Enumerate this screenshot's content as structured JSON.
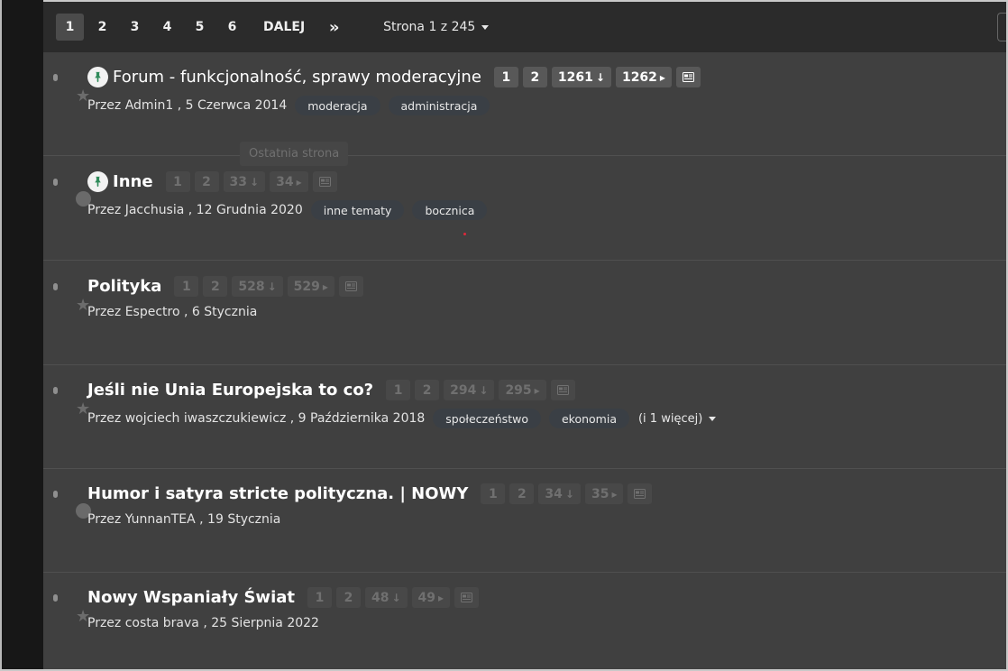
{
  "pagination": {
    "pages": [
      "1",
      "2",
      "3",
      "4",
      "5",
      "6"
    ],
    "next_label": "DALEJ",
    "last_label": "»",
    "page_select": "Strona 1 z 245"
  },
  "tooltip": "Ostatnia strona",
  "threads": [
    {
      "title": "Forum - funkcjonalność, sprawy moderacyjne",
      "pinned": true,
      "pages": [
        "1",
        "2",
        "1261",
        "1262"
      ],
      "meta": "Przez Admin1 , 5 Czerwca 2014",
      "tags": [
        "moderacja",
        "administracja"
      ]
    },
    {
      "title": "Inne",
      "pinned": true,
      "pages": [
        "1",
        "2",
        "33",
        "34"
      ],
      "meta": "Przez Jacchusia , 12 Grudnia 2020",
      "tags": [
        "inne tematy",
        "bocznica"
      ]
    },
    {
      "title": "Polityka",
      "pinned": false,
      "pages": [
        "1",
        "2",
        "528",
        "529"
      ],
      "meta": "Przez Espectro , 6 Stycznia",
      "tags": []
    },
    {
      "title": "Jeśli nie Unia Europejska to co?",
      "pinned": false,
      "pages": [
        "1",
        "2",
        "294",
        "295"
      ],
      "meta": "Przez wojciech iwaszczukiewicz , 9 Października 2018",
      "tags": [
        "społeczeństwo",
        "ekonomia"
      ],
      "more": "(i 1 więcej)"
    },
    {
      "title": "Humor i satyra stricte polityczna. | NOWY",
      "pinned": false,
      "pages": [
        "1",
        "2",
        "34",
        "35"
      ],
      "meta": "Przez YunnanTEA , 19 Stycznia",
      "tags": []
    },
    {
      "title": "Nowy Wspaniały Świat",
      "pinned": false,
      "pages": [
        "1",
        "2",
        "48",
        "49"
      ],
      "meta": "Przez costa brava , 25 Sierpnia 2022",
      "tags": []
    }
  ],
  "icons": {
    "pin": "pushpin-icon",
    "star": "star-icon",
    "arrow_down": "arrow-down-icon",
    "arrow_right": "caret-right-icon",
    "newspaper": "newspaper-icon"
  },
  "colors": {
    "background": "#404040",
    "topbar": "#2b2b2b",
    "pin_green": "#2f8a5a",
    "tag_bg": "#3a3f45"
  }
}
